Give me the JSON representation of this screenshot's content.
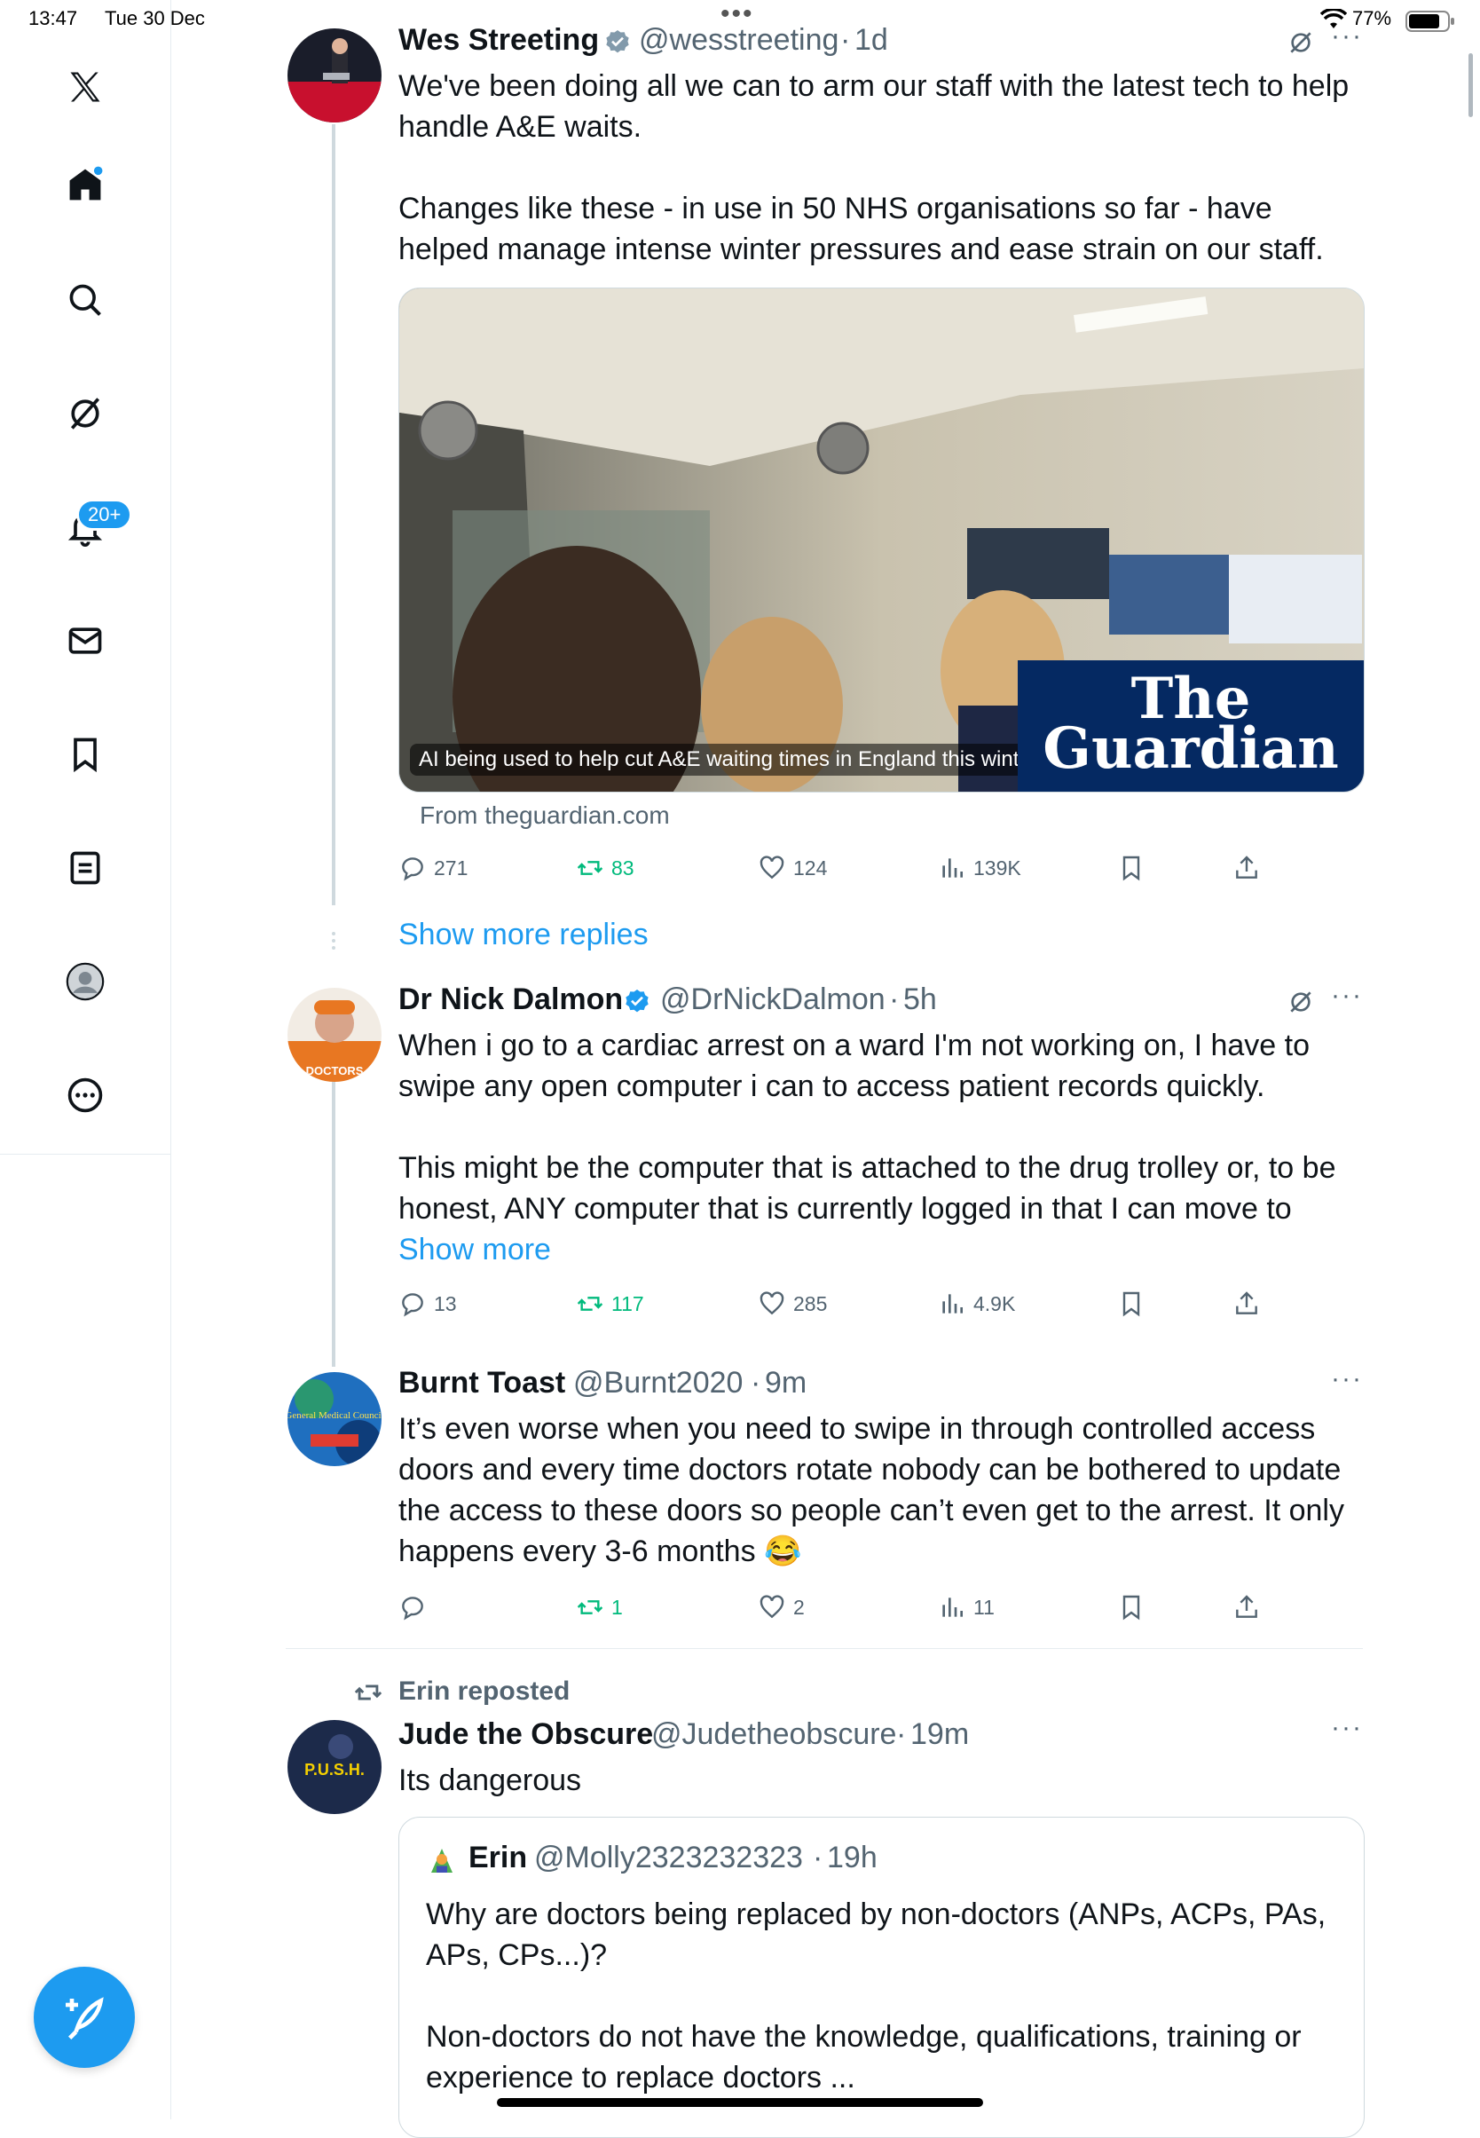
{
  "status_bar": {
    "time": "13:47",
    "date": "Tue 30 Dec",
    "battery": "77%"
  },
  "sidebar": {
    "notifications_badge": "20+",
    "items": [
      "X",
      "Home",
      "Search",
      "Grok",
      "Notifications",
      "Messages",
      "Bookmarks",
      "Lists",
      "Profile",
      "More"
    ]
  },
  "tweets": [
    {
      "name": "Wes Streeting",
      "handle": "@wesstreeting",
      "time": "1d",
      "body_1": "We've been doing all we can to arm our staff with the latest tech to help handle A&E waits.",
      "body_2": "Changes like these - in use in 50 NHS organisations so far - have helped manage intense winter pressures and ease strain on our staff.",
      "card_caption": "AI being used to help cut A&E waiting times in England this winter",
      "card_brand": "The Guardian",
      "card_source": "From theguardian.com",
      "replies": "271",
      "reposts": "83",
      "likes": "124",
      "views": "139K"
    },
    {
      "name": "Dr Nick Dalmon",
      "handle": "@DrNickDalmon",
      "time": "5h",
      "body_1": "When i go to a cardiac arrest on a ward I'm not working on, I have to swipe any open computer i can to access patient records quickly.",
      "body_2": "This might be the computer that is attached to the drug trolley or, to be honest, ANY computer that is currently logged in that I can move to",
      "show_more": "Show more",
      "replies": "13",
      "reposts": "117",
      "likes": "285",
      "views": "4.9K"
    },
    {
      "name": "Burnt Toast",
      "handle": "@Burnt2020",
      "time": "9m",
      "body_1": "It’s even worse when you need to swipe in through controlled access doors and every time doctors rotate nobody can be bothered to update the access to these doors so people can’t even get to the arrest. It only happens every 3-6 months 😂",
      "replies": "",
      "reposts": "1",
      "likes": "2",
      "views": "11"
    },
    {
      "repost_note": "Erin reposted",
      "name": "Jude the Obscure",
      "handle": "@Judetheobscure",
      "time": "19m",
      "body_1": "Its dangerous",
      "quote": {
        "name": "Erin",
        "handle": "@Molly2323232323",
        "time": "19h",
        "body_1": "Why are doctors being replaced by non-doctors (ANPs, ACPs, PAs, APs, CPs...)?",
        "body_2": "Non-doctors do not have the knowledge, qualifications, training or experience to replace doctors ..."
      }
    }
  ],
  "show_more_replies": "Show more replies",
  "avatar_texts": {
    "dalmon": "DOCTORS",
    "burnt": "General Medical Council",
    "jude": "P.U.S.H."
  },
  "colors": {
    "accent": "#1d9bf0",
    "repost_green": "#00ba7c",
    "muted": "#536471",
    "guardian_blue": "#052962"
  },
  "icons": [
    "x-logo-icon",
    "home-icon",
    "search-icon",
    "grok-icon",
    "bell-icon",
    "mail-icon",
    "bookmark-icon",
    "list-icon",
    "profile-icon",
    "more-circle-icon",
    "compose-icon"
  ]
}
